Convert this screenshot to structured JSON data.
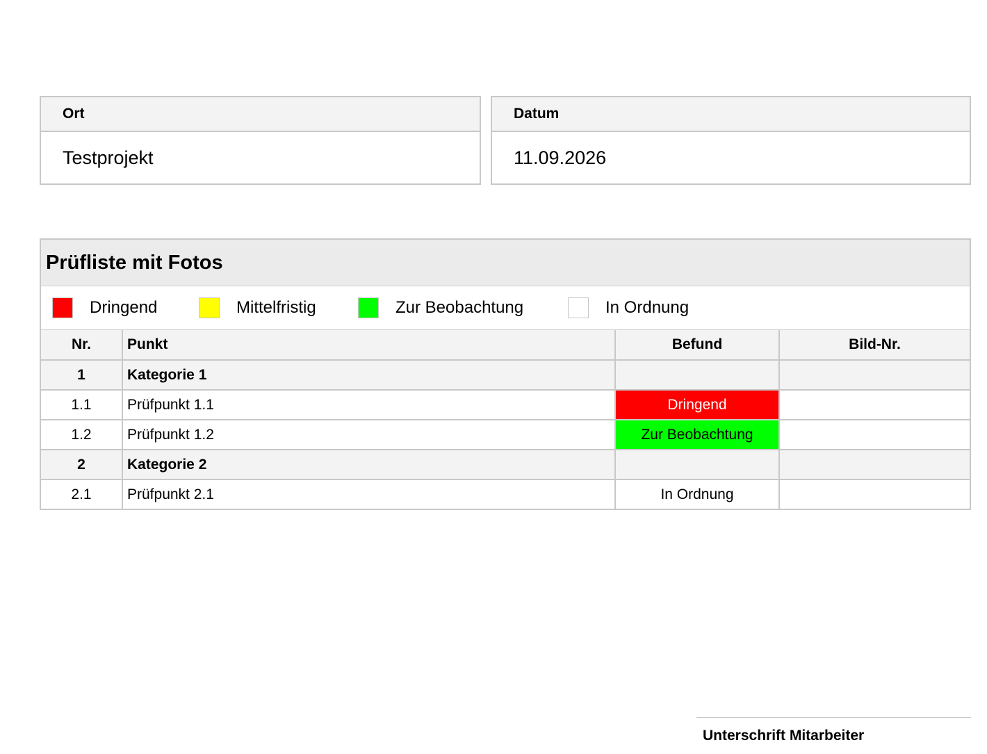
{
  "ort": {
    "label": "Ort",
    "value": "Testprojekt"
  },
  "datum": {
    "label": "Datum",
    "value": "11.09.2026"
  },
  "checklist": {
    "title": "Prüfliste mit Fotos",
    "legend": [
      {
        "label": "Dringend",
        "color": "#ff0000"
      },
      {
        "label": "Mittelfristig",
        "color": "#ffff00"
      },
      {
        "label": "Zur Beobachtung",
        "color": "#00ff00"
      },
      {
        "label": "In Ordnung",
        "color": "#ffffff"
      }
    ],
    "columns": {
      "nr": "Nr.",
      "punkt": "Punkt",
      "befund": "Befund",
      "bild": "Bild-Nr."
    },
    "rows": [
      {
        "nr": "1",
        "punkt": "Kategorie 1",
        "befund": "",
        "bild": "",
        "category": true
      },
      {
        "nr": "1.1",
        "punkt": "Prüfpunkt 1.1",
        "befund": "Dringend",
        "bild": "",
        "befund_bg": "#ff0000",
        "befund_fg": "#ffffff"
      },
      {
        "nr": "1.2",
        "punkt": "Prüfpunkt 1.2",
        "befund": "Zur Beobachtung",
        "bild": "",
        "befund_bg": "#00ff00",
        "befund_fg": "#000000"
      },
      {
        "nr": "2",
        "punkt": "Kategorie 2",
        "befund": "",
        "bild": "",
        "category": true
      },
      {
        "nr": "2.1",
        "punkt": "Prüfpunkt 2.1",
        "befund": "In Ordnung",
        "bild": "",
        "befund_bg": "#ffffff",
        "befund_fg": "#000000"
      }
    ]
  },
  "signature": {
    "label": "Unterschrift Mitarbeiter"
  }
}
